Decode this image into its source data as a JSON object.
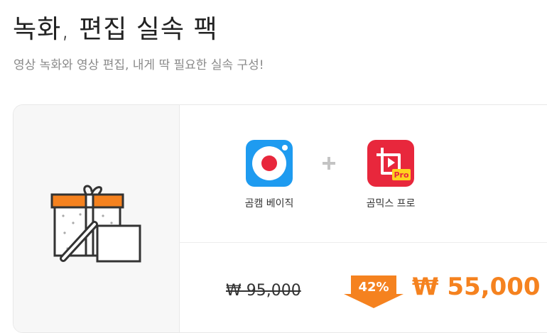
{
  "header": {
    "title": "녹화, 편집 실속 팩",
    "subtitle": "영상 녹화와 영상 편집, 내게 딱 필요한 실속 구성!"
  },
  "bundle": {
    "gift_icon": "gift-box-icon",
    "plus_icon": "plus-icon",
    "products": [
      {
        "name": "곰캠 베이직",
        "icon": "gomcam-record-icon",
        "color": "#1E9BF0"
      },
      {
        "name": "곰믹스 프로",
        "icon": "gommix-pro-icon",
        "color": "#E8273C",
        "badge": "Pro"
      }
    ]
  },
  "pricing": {
    "original_price": "₩ 95,000",
    "discount": "42%",
    "sale_price": "₩ 55,000"
  },
  "colors": {
    "accent_orange": "#F5821F",
    "subtitle_gray": "#8A8A8A"
  }
}
